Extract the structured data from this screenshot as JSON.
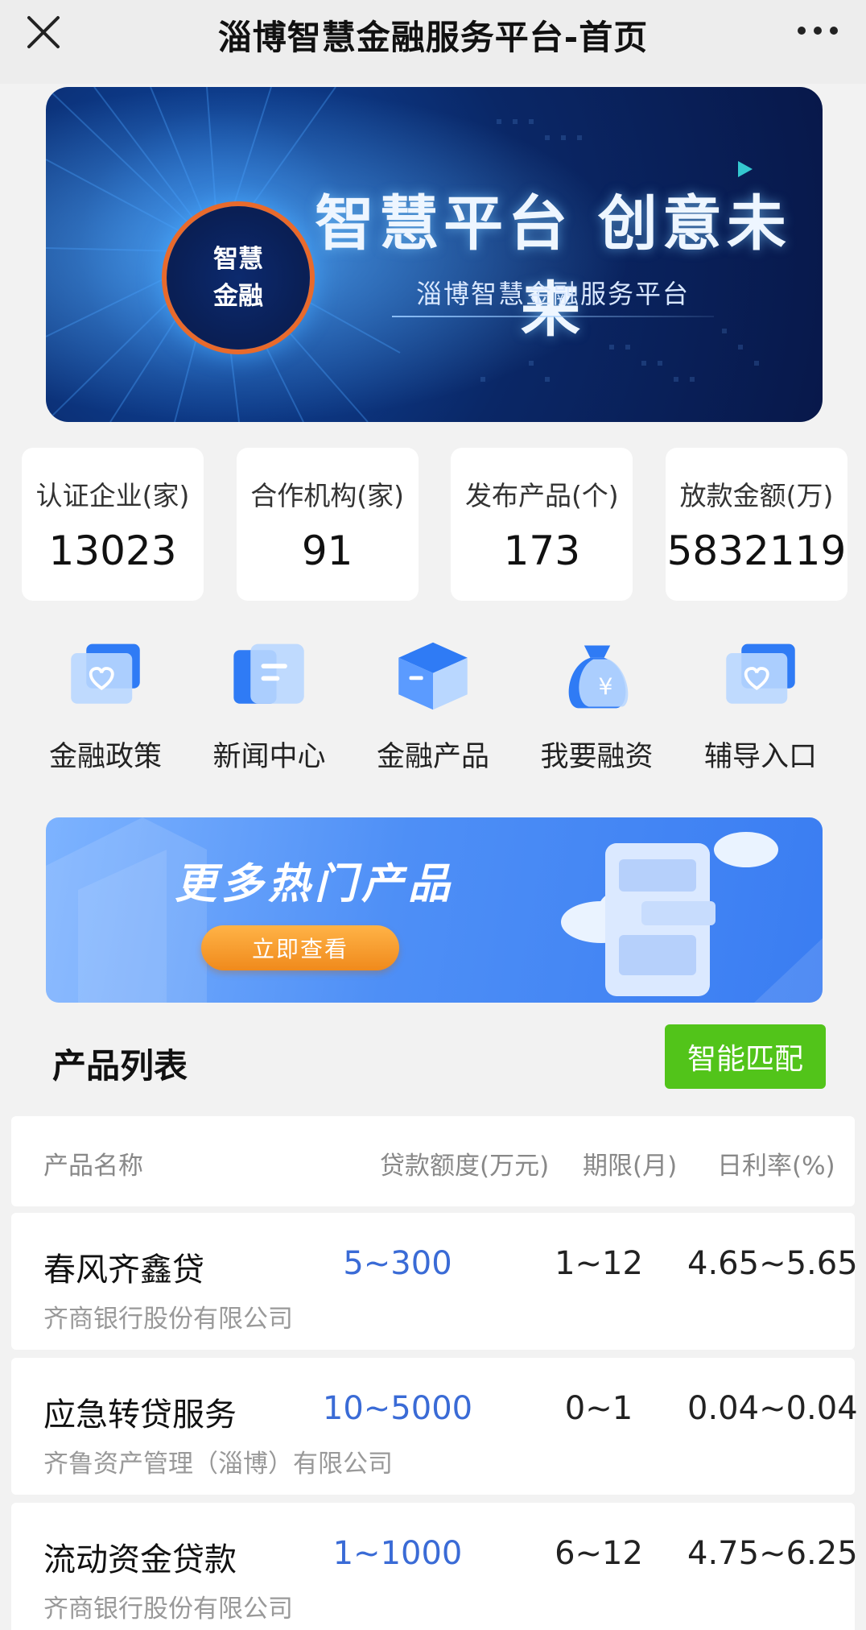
{
  "header": {
    "title": "淄博智慧金融服务平台-首页"
  },
  "hero": {
    "badge_line1": "智慧",
    "badge_line2": "金融",
    "slogan": "智慧平台 创意未来",
    "subtitle": "淄博智慧金融服务平台"
  },
  "stats": [
    {
      "label": "认证企业(家)",
      "value": "13023"
    },
    {
      "label": "合作机构(家)",
      "value": "91"
    },
    {
      "label": "发布产品(个)",
      "value": "173"
    },
    {
      "label": "放款金额(万)",
      "value": "5832119"
    }
  ],
  "quicknav": [
    {
      "label": "金融政策",
      "icon": "heart-card-icon"
    },
    {
      "label": "新闻中心",
      "icon": "news-card-icon"
    },
    {
      "label": "金融产品",
      "icon": "box-icon"
    },
    {
      "label": "我要融资",
      "icon": "money-bag-icon"
    },
    {
      "label": "辅导入口",
      "icon": "heart-card-icon"
    }
  ],
  "promo": {
    "title": "更多热门产品",
    "button": "立即查看"
  },
  "product_list": {
    "title": "产品列表",
    "match_button": "智能匹配",
    "columns": [
      "产品名称",
      "贷款额度(万元)",
      "期限(月)",
      "日利率(%)"
    ],
    "rows": [
      {
        "name": "春风齐鑫贷",
        "org": "齐商银行股份有限公司",
        "amount": "5~300",
        "term": "1~12",
        "rate": "4.65~5.65"
      },
      {
        "name": "应急转贷服务",
        "org": "齐鲁资产管理（淄博）有限公司",
        "amount": "10~5000",
        "term": "0~1",
        "rate": "0.04~0.04"
      },
      {
        "name": "流动资金贷款",
        "org": "齐商银行股份有限公司",
        "amount": "1~1000",
        "term": "6~12",
        "rate": "4.75~6.25"
      }
    ]
  },
  "colors": {
    "accent_blue": "#3a6bd6",
    "match_green": "#52c41a",
    "promo_orange": "#f08a1c"
  }
}
